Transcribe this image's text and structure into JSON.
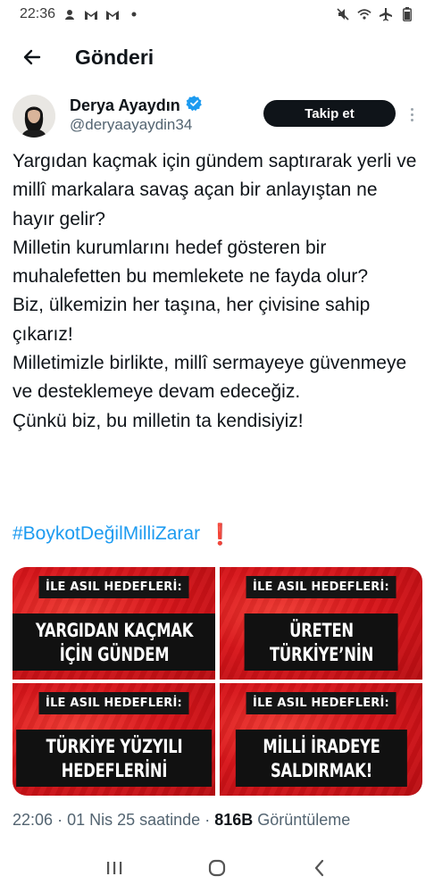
{
  "status_bar": {
    "time": "22:36",
    "left_icons": [
      "notification-icon",
      "gmail-icon",
      "gmail-icon",
      "dot-icon"
    ],
    "right_icons": [
      "mute-icon",
      "wifi-icon",
      "airplane-icon",
      "battery-icon"
    ]
  },
  "header": {
    "title": "Gönderi",
    "back_icon": "arrow-left-icon"
  },
  "author": {
    "name": "Derya Ayaydın",
    "handle": "@deryaayaydin34",
    "verified_icon": "verified-badge-icon",
    "follow_label": "Takip et"
  },
  "tweet": {
    "text": "Yargıdan kaçmak için gündem saptırarak yerli ve millî markalara savaş açan bir anlayıştan ne hayır gelir?\nMilletin kurumlarını hedef gösteren bir muhalefetten bu memlekete ne fayda olur?\nBiz, ülkemizin her taşına, her çivisine sahip çıkarız!\nMilletimizle birlikte, millî sermayeye güvenmeye ve desteklemeye devam edeceğiz.\nÇünkü biz, bu milletin ta kendisiyiz!",
    "hashtag": "#BoykotDeğilMilliZarar",
    "hashtag_emoji": "❗"
  },
  "media": [
    {
      "tag": "İLE ASIL HEDEFLERİ:",
      "headline": "YARGIDAN KAÇMAK\nİÇİN GÜNDEM"
    },
    {
      "tag": "İLE ASIL HEDEFLERİ:",
      "headline": "ÜRETEN\nTÜRKİYE’NİN"
    },
    {
      "tag": "İLE ASIL HEDEFLERİ:",
      "headline": "TÜRKİYE YÜZYILI\nHEDEFLERİNİ"
    },
    {
      "tag": "İLE ASIL HEDEFLERİ:",
      "headline": "MİLLİ İRADEYE\nSALDIRMAK!"
    }
  ],
  "meta": {
    "time": "22:06",
    "date": "01 Nis 25 saatinde",
    "views_count": "816B",
    "views_label": "Görüntüleme"
  },
  "nav_bar": {
    "icons": [
      "recent-apps-icon",
      "home-icon",
      "back-icon"
    ]
  },
  "colors": {
    "accent": "#1d9bf0",
    "text": "#0f1419",
    "muted": "#536471",
    "tile_red": "#d8151a"
  }
}
